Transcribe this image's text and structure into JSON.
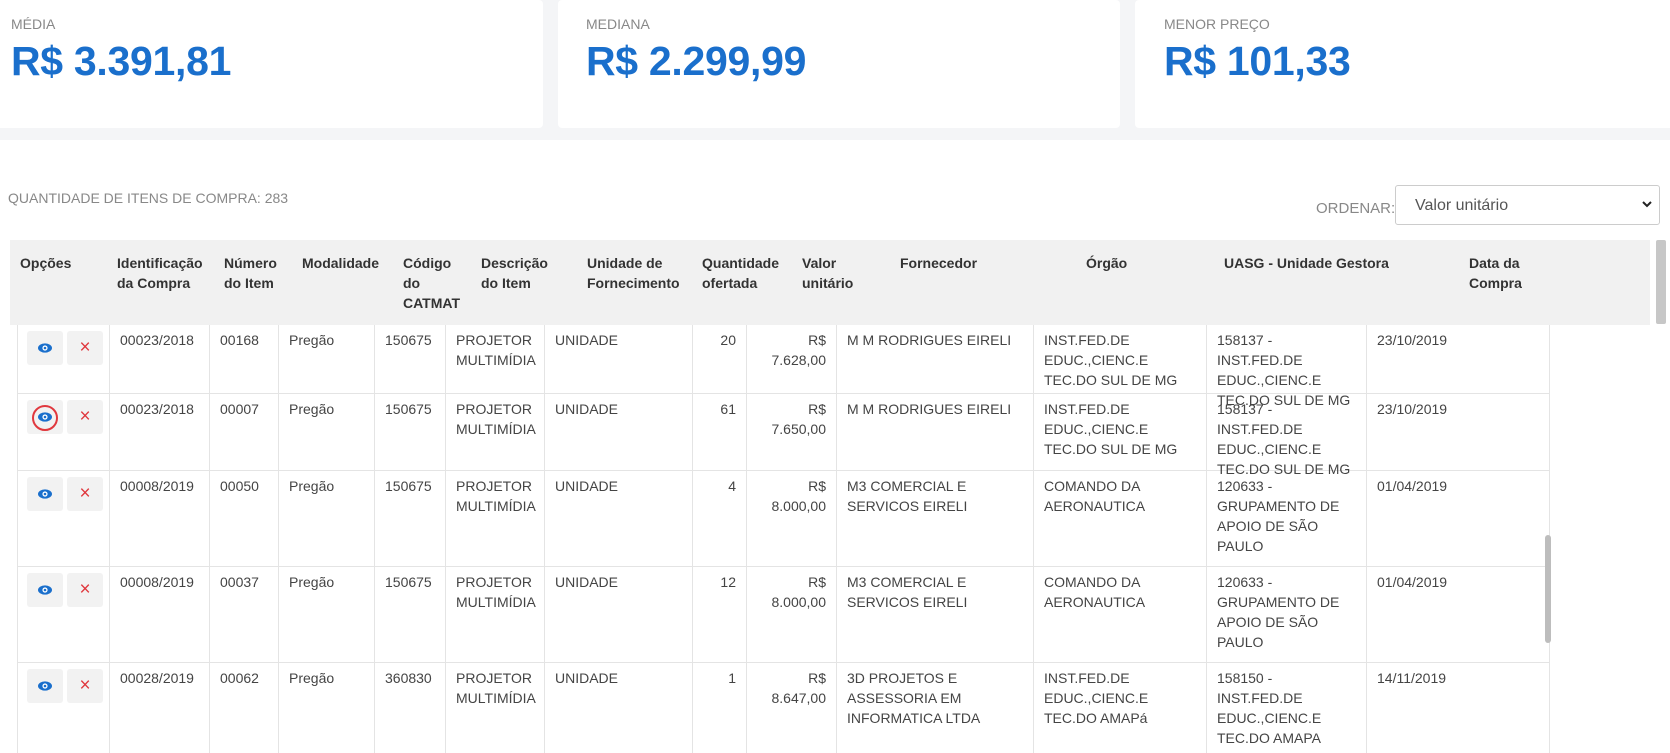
{
  "stats": {
    "media": {
      "label": "MÉDIA",
      "value": "R$ 3.391,81"
    },
    "mediana": {
      "label": "MEDIANA",
      "value": "R$ 2.299,99"
    },
    "menor": {
      "label": "MENOR PREÇO",
      "value": "R$ 101,33"
    }
  },
  "quantity_text": "QUANTIDADE DE ITENS DE COMPRA: 283",
  "order": {
    "label": "ORDENAR:",
    "selected": "Valor unitário"
  },
  "table": {
    "headers": {
      "opcoes": "Opções",
      "identificacao": "Identificação da Compra",
      "numero": "Número do Item",
      "modalidade": "Modalidade",
      "codigo": "Código do CATMAT",
      "descricao": "Descrição do Item",
      "unidade": "Unidade de Fornecimento",
      "quantidade": "Quantidade ofertada",
      "valor": "Valor unitário",
      "fornecedor": "Fornecedor",
      "orgao": "Órgão",
      "uasg": "UASG - Unidade Gestora",
      "data": "Data da Compra"
    },
    "rows": [
      {
        "identificacao": "00023/2018",
        "numero": "00168",
        "modalidade": "Pregão",
        "codigo": "150675",
        "descricao": "PROJETOR MULTIMÍDIA",
        "unidade": "UNIDADE",
        "quantidade": "20",
        "valor": "R$ 7.628,00",
        "fornecedor": "M M RODRIGUES EIRELI",
        "orgao": "INST.FED.DE EDUC.,CIENC.E TEC.DO SUL DE MG",
        "uasg": "158137 - INST.FED.DE EDUC.,CIENC.E TEC.DO SUL DE MG",
        "data": "23/10/2019"
      },
      {
        "identificacao": "00023/2018",
        "numero": "00007",
        "modalidade": "Pregão",
        "codigo": "150675",
        "descricao": "PROJETOR MULTIMÍDIA",
        "unidade": "UNIDADE",
        "quantidade": "61",
        "valor": "R$ 7.650,00",
        "fornecedor": "M M RODRIGUES EIRELI",
        "orgao": "INST.FED.DE EDUC.,CIENC.E TEC.DO SUL DE MG",
        "uasg": "158137 - INST.FED.DE EDUC.,CIENC.E TEC.DO SUL DE MG",
        "data": "23/10/2019"
      },
      {
        "identificacao": "00008/2019",
        "numero": "00050",
        "modalidade": "Pregão",
        "codigo": "150675",
        "descricao": "PROJETOR MULTIMÍDIA",
        "unidade": "UNIDADE",
        "quantidade": "4",
        "valor": "R$ 8.000,00",
        "fornecedor": "M3 COMERCIAL E SERVICOS EIRELI",
        "orgao": "COMANDO DA AERONAUTICA",
        "uasg": "120633 - GRUPAMENTO DE APOIO DE SÃO PAULO",
        "data": "01/04/2019"
      },
      {
        "identificacao": "00008/2019",
        "numero": "00037",
        "modalidade": "Pregão",
        "codigo": "150675",
        "descricao": "PROJETOR MULTIMÍDIA",
        "unidade": "UNIDADE",
        "quantidade": "12",
        "valor": "R$ 8.000,00",
        "fornecedor": "M3 COMERCIAL E SERVICOS EIRELI",
        "orgao": "COMANDO DA AERONAUTICA",
        "uasg": "120633 - GRUPAMENTO DE APOIO DE SÃO PAULO",
        "data": "01/04/2019"
      },
      {
        "identificacao": "00028/2019",
        "numero": "00062",
        "modalidade": "Pregão",
        "codigo": "360830",
        "descricao": "PROJETOR MULTIMÍDIA",
        "unidade": "UNIDADE",
        "quantidade": "1",
        "valor": "R$ 8.647,00",
        "fornecedor": "3D PROJETOS E ASSESSORIA EM INFORMATICA LTDA",
        "orgao": "INST.FED.DE EDUC.,CIENC.E TEC.DO AMAPá",
        "uasg": "158150 - INST.FED.DE EDUC.,CIENC.E TEC.DO AMAPA",
        "data": "14/11/2019"
      }
    ]
  },
  "icons": {
    "view": "eye-icon",
    "delete": "close-icon",
    "select": "chevron-down-icon"
  },
  "colors": {
    "accent": "#1a6fcc",
    "danger": "#e0383e"
  }
}
